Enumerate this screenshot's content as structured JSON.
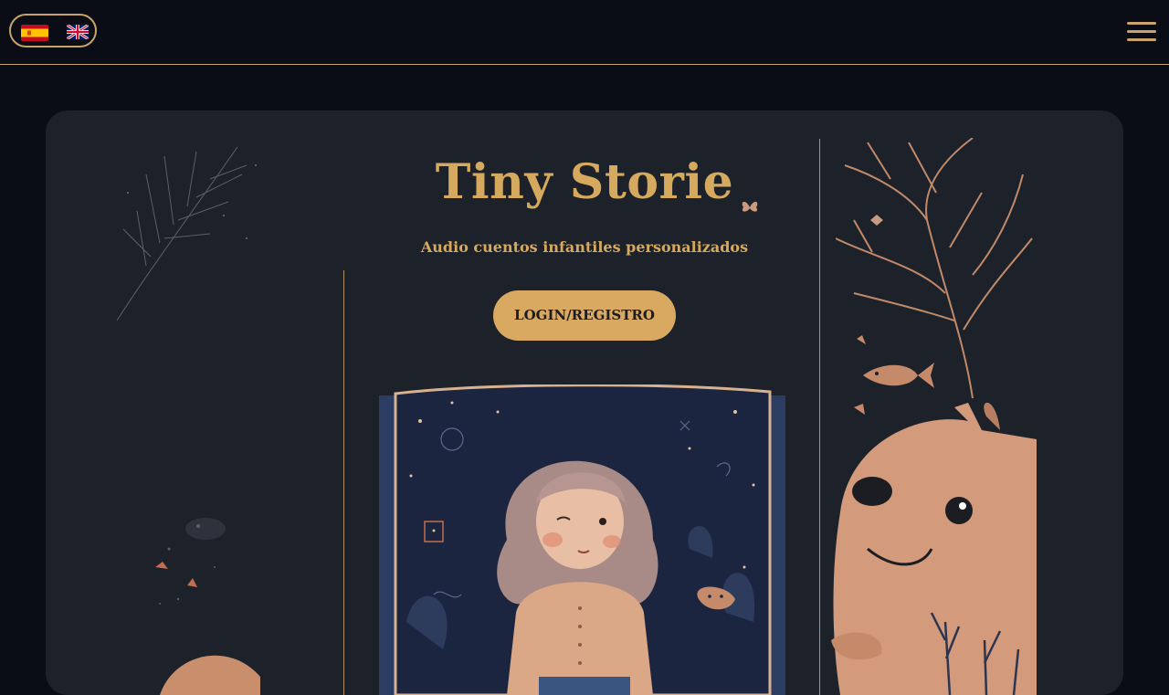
{
  "header": {
    "languages": [
      {
        "code": "es",
        "icon": "spain-flag-icon"
      },
      {
        "code": "en",
        "icon": "uk-flag-icon"
      }
    ],
    "menu_icon": "hamburger-menu-icon",
    "accent_color": "#c9a46a"
  },
  "hero": {
    "title": "Tiny Storie",
    "subtitle": "Audio cuentos infantiles personalizados",
    "login_label": "LOGIN/REGISTRO",
    "accent_color": "#d5aa5e",
    "card_color": "#1d2129"
  }
}
